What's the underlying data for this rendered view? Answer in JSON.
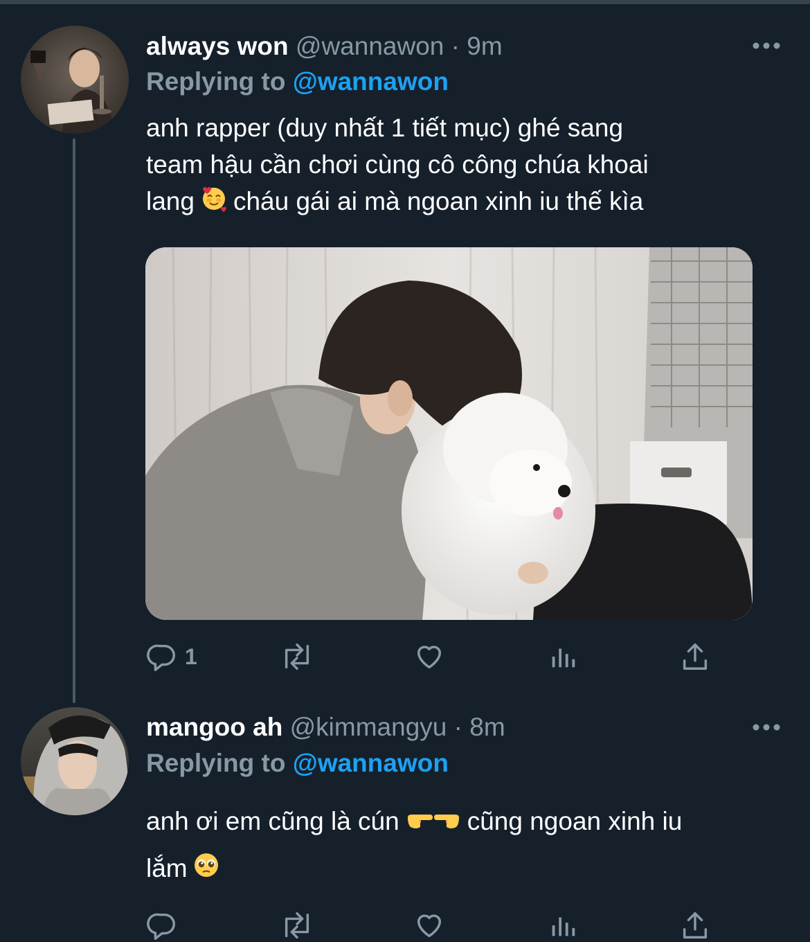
{
  "tweets": [
    {
      "display_name": "always won",
      "handle": "@wannawon",
      "separator": "·",
      "time": "9m",
      "replying_label": "Replying to",
      "replying_handle": "@wannawon",
      "text_lines": [
        "anh rapper (duy nhất 1 tiết mục) ghé sang",
        "team hậu cần chơi cùng cô công chúa khoai",
        "lang",
        "cháu gái ai mà ngoan xinh iu thế kìa"
      ],
      "emoji": [
        "smiling-face-with-hearts"
      ],
      "has_image": true,
      "image_subject": "man-kissing-white-poodle",
      "counts": {
        "reply": "1"
      }
    },
    {
      "display_name": "mangoo ah",
      "handle": "@kimmangyu",
      "separator": "·",
      "time": "8m",
      "replying_label": "Replying to",
      "replying_handle": "@wannawon",
      "text_lines": [
        "anh ơi em cũng là cún",
        "cũng ngoan xinh iu",
        "lắm"
      ],
      "emoji": [
        "backhand-index-pointing-right",
        "backhand-index-pointing-left",
        "pleading-face"
      ],
      "has_image": false
    }
  ],
  "colors": {
    "background": "#15202b",
    "secondary_text": "#8899a6",
    "link": "#1da1f2",
    "thread_line": "#4b5963"
  },
  "icons": [
    "more-icon",
    "reply-icon",
    "retweet-icon",
    "like-icon",
    "analytics-icon",
    "share-icon"
  ]
}
